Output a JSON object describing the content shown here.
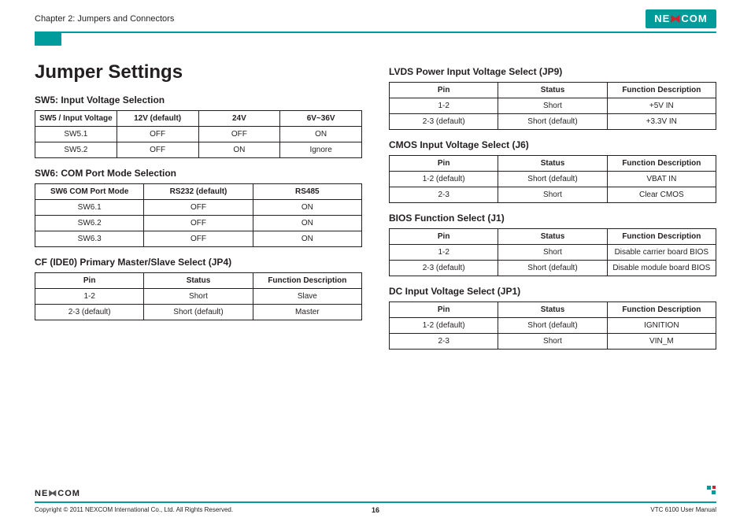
{
  "header": {
    "chapter": "Chapter 2: Jumpers and Connectors",
    "brand": "NE COM",
    "brand_inner": "X"
  },
  "page_title": "Jumper Settings",
  "left": {
    "sw5": {
      "heading": "SW5: Input Voltage Selection",
      "h0": "SW5 / Input Voltage",
      "h1": "12V (default)",
      "h2": "24V",
      "h3": "6V~36V",
      "r0c0": "SW5.1",
      "r0c1": "OFF",
      "r0c2": "OFF",
      "r0c3": "ON",
      "r1c0": "SW5.2",
      "r1c1": "OFF",
      "r1c2": "ON",
      "r1c3": "Ignore"
    },
    "sw6": {
      "heading": "SW6: COM Port Mode Selection",
      "h0": "SW6 COM Port Mode",
      "h1": "RS232 (default)",
      "h2": "RS485",
      "r0c0": "SW6.1",
      "r0c1": "OFF",
      "r0c2": "ON",
      "r1c0": "SW6.2",
      "r1c1": "OFF",
      "r1c2": "ON",
      "r2c0": "SW6.3",
      "r2c1": "OFF",
      "r2c2": "ON"
    },
    "jp4": {
      "heading": "CF (IDE0) Primary Master/Slave Select (JP4)",
      "h0": "Pin",
      "h1": "Status",
      "h2": "Function Description",
      "r0c0": "1-2",
      "r0c1": "Short",
      "r0c2": "Slave",
      "r1c0": "2-3 (default)",
      "r1c1": "Short (default)",
      "r1c2": "Master"
    }
  },
  "right": {
    "jp9": {
      "heading": "LVDS Power Input Voltage Select (JP9)",
      "h0": "Pin",
      "h1": "Status",
      "h2": "Function Description",
      "r0c0": "1-2",
      "r0c1": "Short",
      "r0c2": "+5V IN",
      "r1c0": "2-3 (default)",
      "r1c1": "Short (default)",
      "r1c2": "+3.3V IN"
    },
    "j6": {
      "heading": "CMOS Input Voltage Select (J6)",
      "h0": "Pin",
      "h1": "Status",
      "h2": "Function Description",
      "r0c0": "1-2 (default)",
      "r0c1": "Short (default)",
      "r0c2": "VBAT IN",
      "r1c0": "2-3",
      "r1c1": "Short",
      "r1c2": "Clear CMOS"
    },
    "j1": {
      "heading": "BIOS Function Select (J1)",
      "h0": "Pin",
      "h1": "Status",
      "h2": "Function Description",
      "r0c0": "1-2",
      "r0c1": "Short",
      "r0c2": "Disable carrier board BIOS",
      "r1c0": "2-3 (default)",
      "r1c1": "Short (default)",
      "r1c2": "Disable module board BIOS"
    },
    "jp1": {
      "heading": "DC Input Voltage Select (JP1)",
      "h0": "Pin",
      "h1": "Status",
      "h2": "Function Description",
      "r0c0": "1-2 (default)",
      "r0c1": "Short (default)",
      "r0c2": "IGNITION",
      "r1c0": "2-3",
      "r1c1": "Short",
      "r1c2": "VIN_M"
    }
  },
  "footer": {
    "brand_small": "NEXCOM",
    "copyright": "Copyright © 2011 NEXCOM International Co., Ltd. All Rights Reserved.",
    "page_number": "16",
    "doc": "VTC 6100 User Manual"
  }
}
